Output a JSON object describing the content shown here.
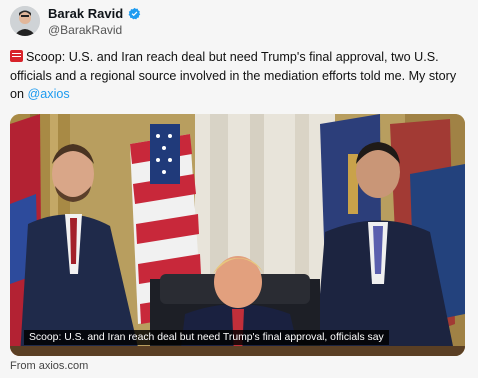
{
  "author": {
    "display_name": "Barak Ravid",
    "handle": "@BarakRavid",
    "verified": true,
    "avatar_icon": "profile-photo"
  },
  "tweet": {
    "emoji_icon": "newspaper-emoji",
    "text_part1": "Scoop: U.S. and Iran reach deal but need Trump's final approval, two U.S. officials and a regional source involved in the mediation efforts told me. My story on ",
    "mention": "@axios"
  },
  "media": {
    "caption": "Scoop: U.S. and Iran reach deal but need Trump's final approval, officials say",
    "source": "From axios.com"
  },
  "colors": {
    "link": "#1d9bf0",
    "verified_badge": "#1d9bf0"
  }
}
